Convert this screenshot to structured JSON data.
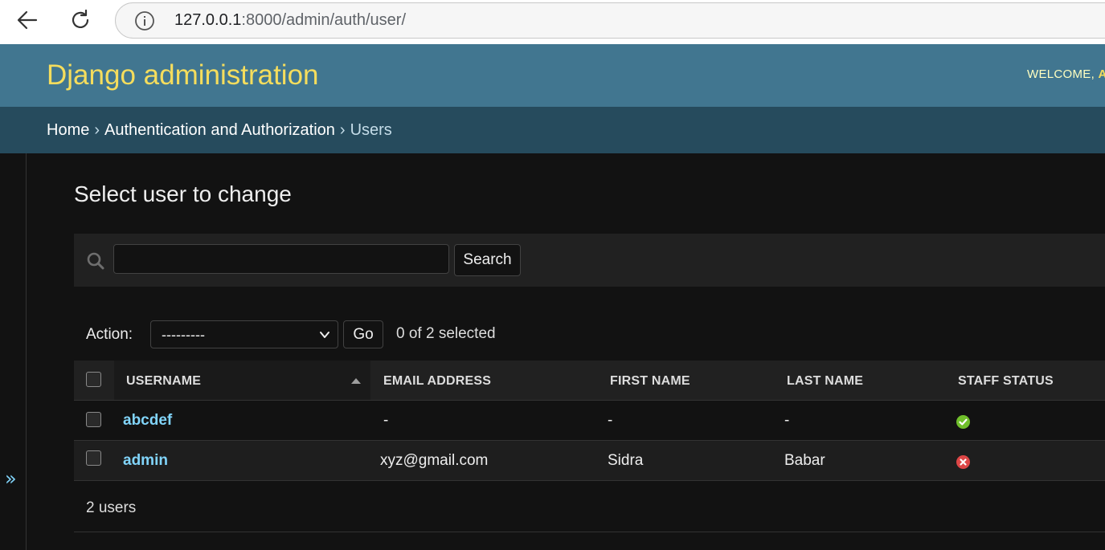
{
  "browser": {
    "url_host": "127.0.0.1",
    "url_rest": ":8000/admin/auth/user/"
  },
  "header": {
    "site_title": "Django administration",
    "welcome": "WELCOME,",
    "welcome_user": "A"
  },
  "breadcrumbs": {
    "home": "Home",
    "sep": "›",
    "app": "Authentication and Authorization",
    "current": "Users"
  },
  "sidebar": {
    "toggle": "»"
  },
  "page": {
    "title": "Select user to change"
  },
  "search": {
    "button_label": "Search",
    "value": ""
  },
  "actions": {
    "label": "Action:",
    "selected_option": "---------",
    "go_label": "Go",
    "selected_count": "0 of 2 selected"
  },
  "table": {
    "columns": [
      "USERNAME",
      "EMAIL ADDRESS",
      "FIRST NAME",
      "LAST NAME",
      "STAFF STATUS"
    ],
    "rows": [
      {
        "username": "abcdef",
        "email": "-",
        "first_name": "-",
        "last_name": "-",
        "staff_status": true
      },
      {
        "username": "admin",
        "email": "xyz@gmail.com",
        "first_name": "Sidra",
        "last_name": "Babar",
        "staff_status": false
      }
    ]
  },
  "paginator": {
    "count": "2 users"
  },
  "colors": {
    "header_bg": "#417690",
    "breadcrumbs_bg": "#264b5d",
    "site_title": "#f5dd5d",
    "link": "#81d4fa",
    "status_true": "#70bf2b",
    "status_false": "#dd4646"
  }
}
